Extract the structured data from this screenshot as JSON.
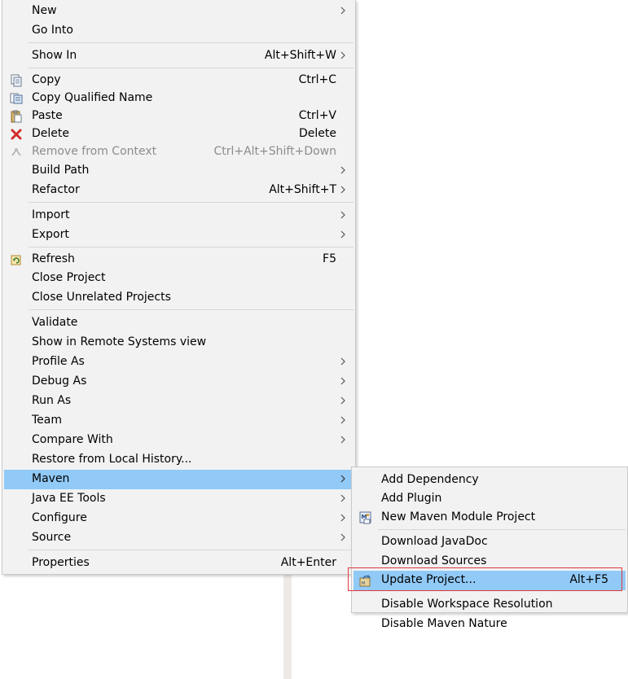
{
  "main_menu": {
    "new": {
      "label": "New"
    },
    "go_into": {
      "label": "Go Into"
    },
    "show_in": {
      "label": "Show In",
      "shortcut": "Alt+Shift+W"
    },
    "copy": {
      "label": "Copy",
      "shortcut": "Ctrl+C",
      "icon": "copy-icon"
    },
    "copy_qualified_name": {
      "label": "Copy Qualified Name",
      "icon": "copy-qualified-name-icon"
    },
    "paste": {
      "label": "Paste",
      "shortcut": "Ctrl+V",
      "icon": "paste-icon"
    },
    "delete": {
      "label": "Delete",
      "shortcut": "Delete",
      "icon": "delete-icon"
    },
    "remove_from_context": {
      "label": "Remove from Context",
      "shortcut": "Ctrl+Alt+Shift+Down",
      "icon": "remove-context-icon",
      "enabled": false
    },
    "build_path": {
      "label": "Build Path"
    },
    "refactor": {
      "label": "Refactor",
      "shortcut": "Alt+Shift+T"
    },
    "import": {
      "label": "Import"
    },
    "export": {
      "label": "Export"
    },
    "refresh": {
      "label": "Refresh",
      "shortcut": "F5",
      "icon": "refresh-icon"
    },
    "close_project": {
      "label": "Close Project"
    },
    "close_unrelated_projects": {
      "label": "Close Unrelated Projects"
    },
    "validate": {
      "label": "Validate"
    },
    "show_in_remote_systems": {
      "label": "Show in Remote Systems view"
    },
    "profile_as": {
      "label": "Profile As"
    },
    "debug_as": {
      "label": "Debug As"
    },
    "run_as": {
      "label": "Run As"
    },
    "team": {
      "label": "Team"
    },
    "compare_with": {
      "label": "Compare With"
    },
    "restore_from_local_history": {
      "label": "Restore from Local History..."
    },
    "maven": {
      "label": "Maven",
      "highlighted": true
    },
    "java_ee_tools": {
      "label": "Java EE Tools"
    },
    "configure": {
      "label": "Configure"
    },
    "source": {
      "label": "Source"
    },
    "properties": {
      "label": "Properties",
      "shortcut": "Alt+Enter"
    }
  },
  "maven_submenu": {
    "add_dependency": {
      "label": "Add Dependency"
    },
    "add_plugin": {
      "label": "Add Plugin"
    },
    "new_maven_module_project": {
      "label": "New Maven Module Project",
      "icon": "maven-module-icon"
    },
    "download_javadoc": {
      "label": "Download JavaDoc"
    },
    "download_sources": {
      "label": "Download Sources"
    },
    "update_project": {
      "label": "Update Project...",
      "shortcut": "Alt+F5",
      "icon": "update-project-icon",
      "highlighted": true
    },
    "disable_workspace_resolution": {
      "label": "Disable Workspace Resolution"
    },
    "disable_maven_nature": {
      "label": "Disable Maven Nature"
    }
  },
  "colors": {
    "menu_background": "#f2f2f2",
    "highlight": "#91c9f7",
    "separator": "#d6d6d6",
    "callout_border": "#e0383e",
    "disabled_text": "#8c8c8c"
  }
}
